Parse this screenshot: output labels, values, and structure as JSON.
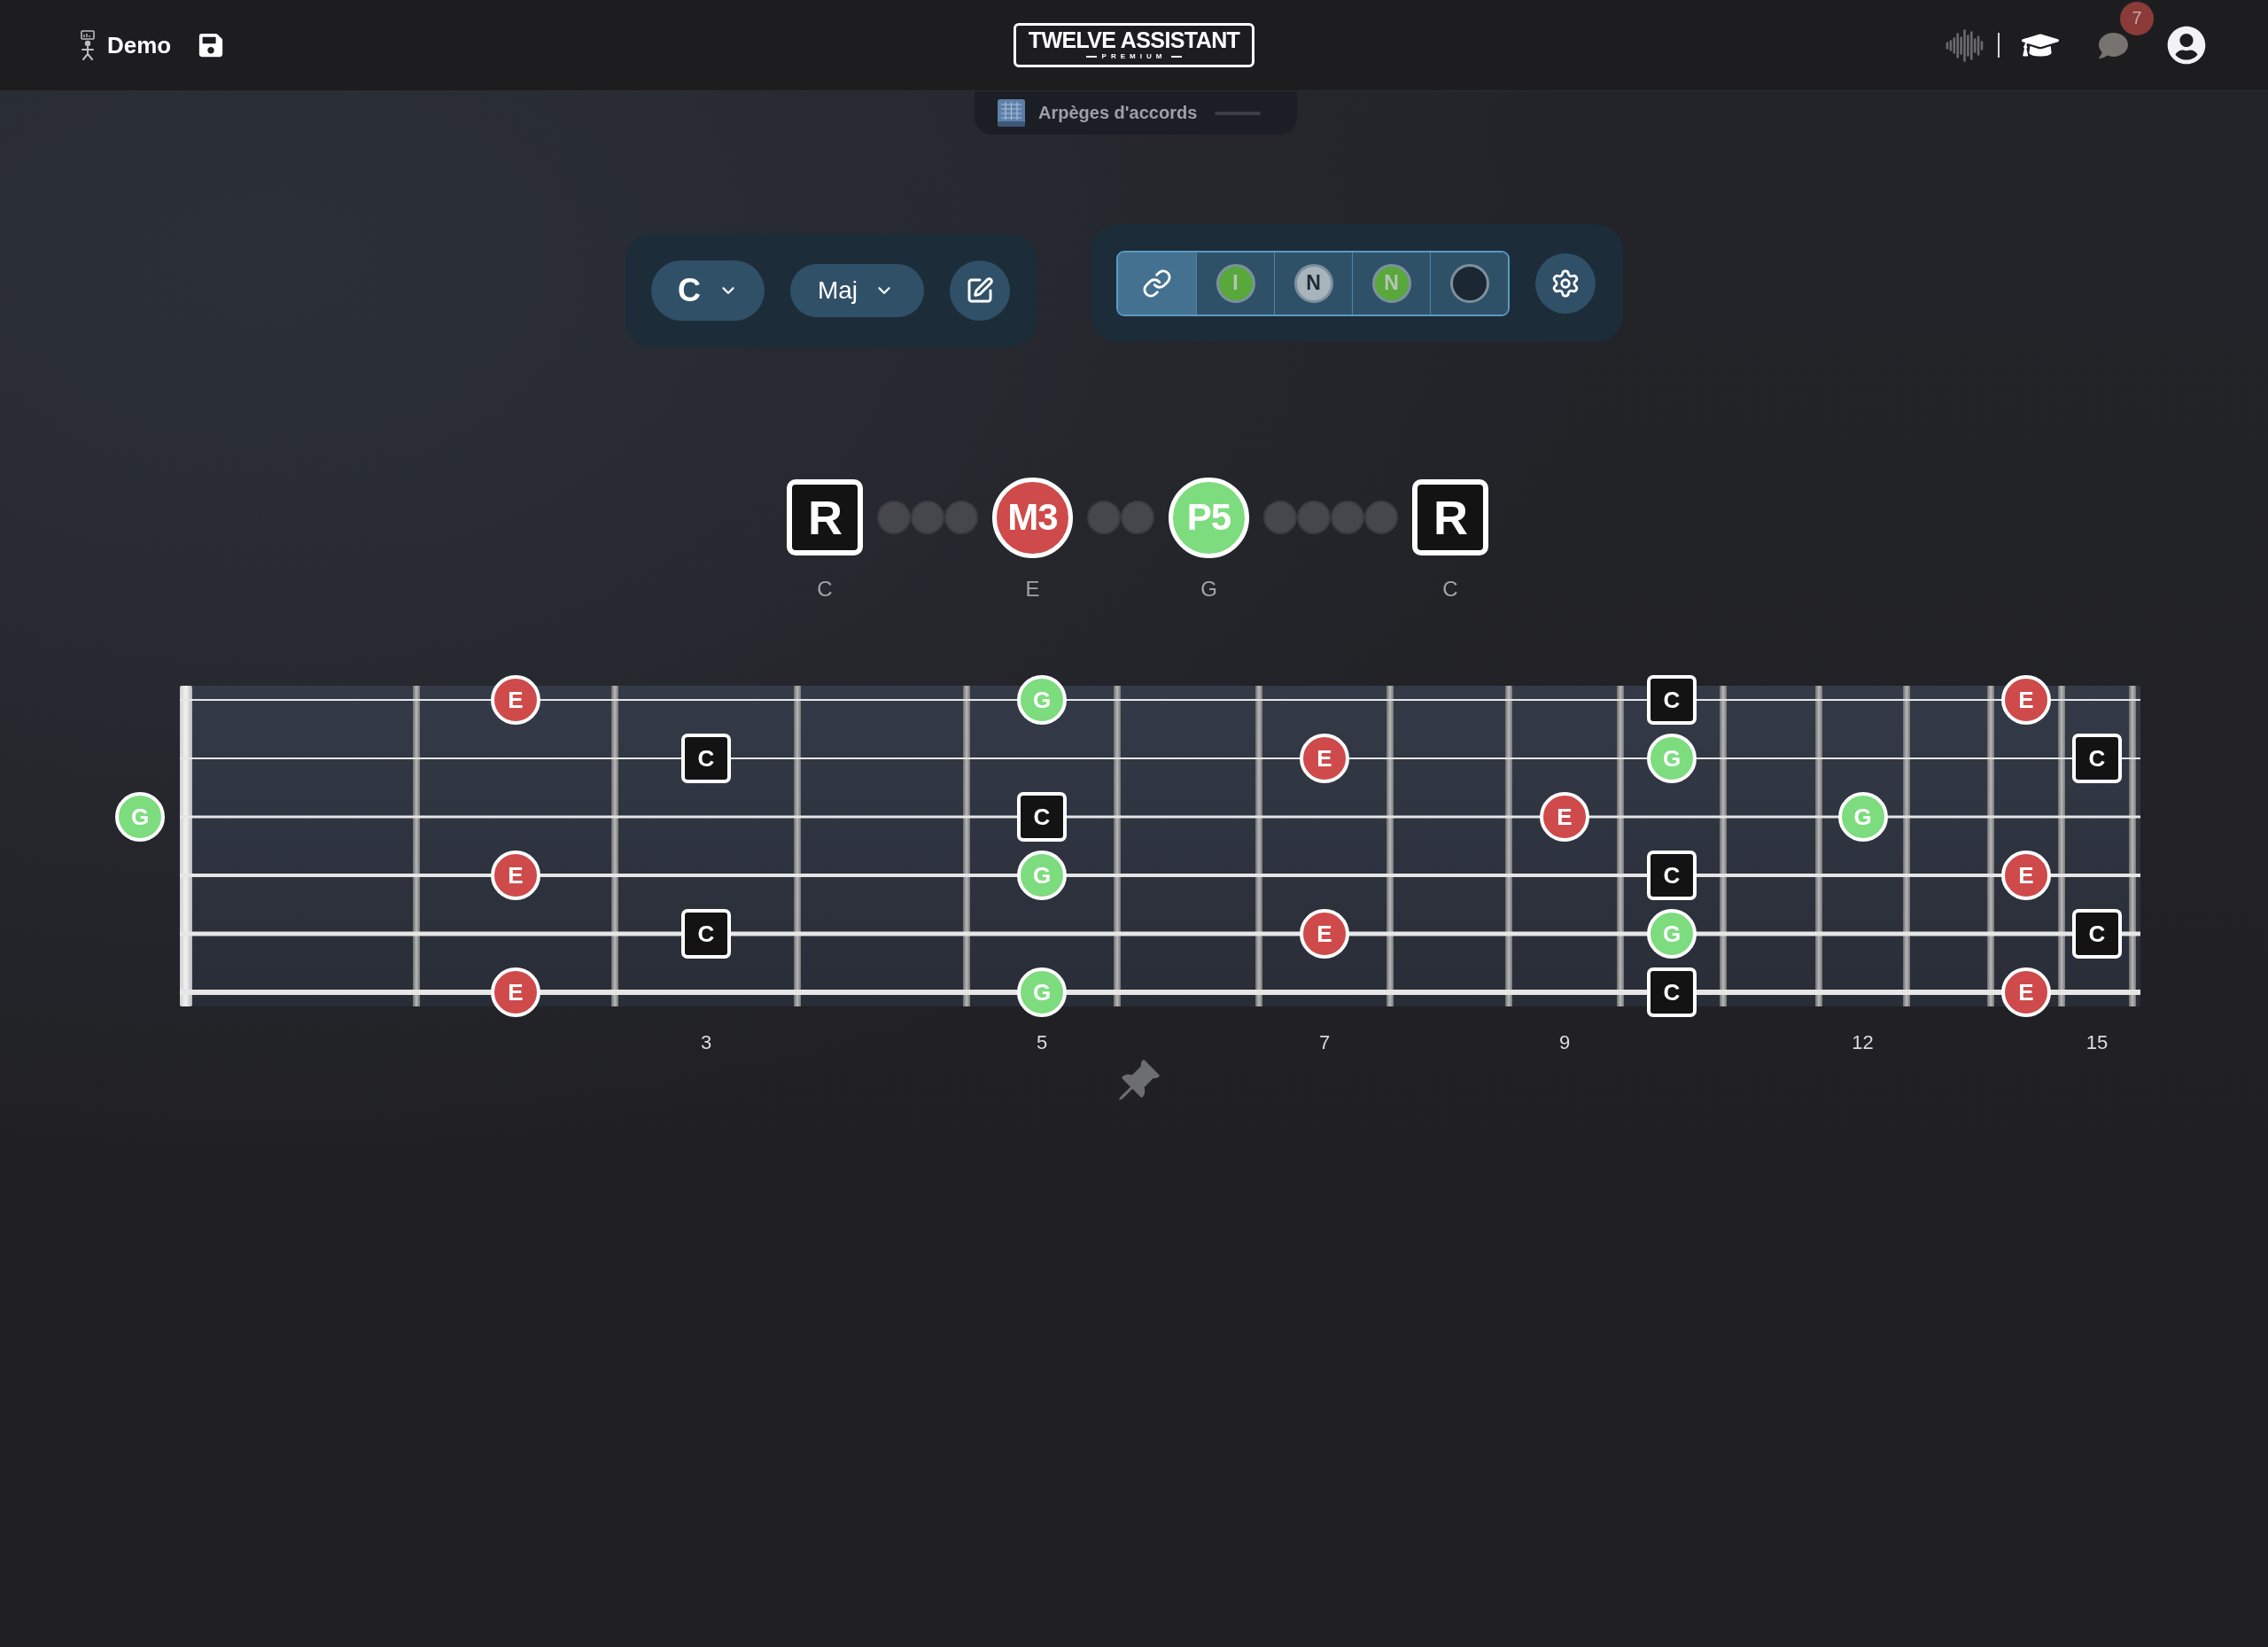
{
  "header": {
    "project_name": "Demo",
    "logo": {
      "title": "TWELVE ASSISTANT",
      "subtitle": "PREMIUM"
    },
    "notifications": {
      "count": "7"
    }
  },
  "mode_tab": {
    "label": "Arpèges d'accords"
  },
  "chord_controls": {
    "root": "C",
    "quality": "Maj"
  },
  "display_modes": [
    {
      "kind": "link",
      "selected": true
    },
    {
      "kind": "disc",
      "label": "I",
      "color": "#58a83c",
      "selected": false
    },
    {
      "kind": "disc",
      "label": "N",
      "color": "#a8b4bc",
      "selected": false
    },
    {
      "kind": "disc",
      "label": "N",
      "color": "#58a83c",
      "selected": false
    },
    {
      "kind": "disc",
      "color": "#1b2833",
      "selected": false
    }
  ],
  "intervals": [
    {
      "kind": "root",
      "label": "R",
      "note": "C"
    },
    {
      "kind": "gap"
    },
    {
      "kind": "gap"
    },
    {
      "kind": "gap"
    },
    {
      "kind": "third",
      "label": "M3",
      "note": "E"
    },
    {
      "kind": "gap"
    },
    {
      "kind": "gap"
    },
    {
      "kind": "fifth",
      "label": "P5",
      "note": "G"
    },
    {
      "kind": "gap"
    },
    {
      "kind": "gap"
    },
    {
      "kind": "gap"
    },
    {
      "kind": "gap"
    },
    {
      "kind": "root",
      "label": "R",
      "note": "C"
    }
  ],
  "fretboard": {
    "strings": [
      {
        "frets": [
          {
            "kind": "empty"
          },
          {
            "kind": "empty"
          },
          {
            "kind": "third",
            "label": "E"
          },
          {
            "kind": "empty"
          },
          {
            "kind": "empty"
          },
          {
            "kind": "fifth",
            "label": "G"
          },
          {
            "kind": "empty"
          },
          {
            "kind": "empty"
          },
          {
            "kind": "empty"
          },
          {
            "kind": "empty"
          },
          {
            "kind": "root",
            "label": "C"
          },
          {
            "kind": "empty"
          },
          {
            "kind": "empty"
          },
          {
            "kind": "empty"
          },
          {
            "kind": "third",
            "label": "E"
          },
          {
            "kind": "empty"
          }
        ]
      },
      {
        "frets": [
          {
            "kind": "empty"
          },
          {
            "kind": "empty"
          },
          {
            "kind": "empty"
          },
          {
            "kind": "root",
            "label": "C"
          },
          {
            "kind": "empty"
          },
          {
            "kind": "empty"
          },
          {
            "kind": "empty"
          },
          {
            "kind": "third",
            "label": "E"
          },
          {
            "kind": "empty"
          },
          {
            "kind": "empty"
          },
          {
            "kind": "fifth",
            "label": "G"
          },
          {
            "kind": "empty"
          },
          {
            "kind": "empty"
          },
          {
            "kind": "empty"
          },
          {
            "kind": "empty"
          },
          {
            "kind": "root",
            "label": "C"
          }
        ]
      },
      {
        "frets": [
          {
            "kind": "fifth",
            "label": "G"
          },
          {
            "kind": "empty"
          },
          {
            "kind": "empty"
          },
          {
            "kind": "empty"
          },
          {
            "kind": "empty"
          },
          {
            "kind": "root",
            "label": "C"
          },
          {
            "kind": "empty"
          },
          {
            "kind": "empty"
          },
          {
            "kind": "empty"
          },
          {
            "kind": "third",
            "label": "E"
          },
          {
            "kind": "empty"
          },
          {
            "kind": "empty"
          },
          {
            "kind": "fifth",
            "label": "G"
          },
          {
            "kind": "empty"
          },
          {
            "kind": "empty"
          },
          {
            "kind": "empty"
          }
        ]
      },
      {
        "frets": [
          {
            "kind": "empty"
          },
          {
            "kind": "empty"
          },
          {
            "kind": "third",
            "label": "E"
          },
          {
            "kind": "empty"
          },
          {
            "kind": "empty"
          },
          {
            "kind": "fifth",
            "label": "G"
          },
          {
            "kind": "empty"
          },
          {
            "kind": "empty"
          },
          {
            "kind": "empty"
          },
          {
            "kind": "empty"
          },
          {
            "kind": "root",
            "label": "C"
          },
          {
            "kind": "empty"
          },
          {
            "kind": "empty"
          },
          {
            "kind": "empty"
          },
          {
            "kind": "third",
            "label": "E"
          },
          {
            "kind": "empty"
          }
        ]
      },
      {
        "frets": [
          {
            "kind": "empty"
          },
          {
            "kind": "empty"
          },
          {
            "kind": "empty"
          },
          {
            "kind": "root",
            "label": "C"
          },
          {
            "kind": "empty"
          },
          {
            "kind": "empty"
          },
          {
            "kind": "empty"
          },
          {
            "kind": "third",
            "label": "E"
          },
          {
            "kind": "empty"
          },
          {
            "kind": "empty"
          },
          {
            "kind": "fifth",
            "label": "G"
          },
          {
            "kind": "empty"
          },
          {
            "kind": "empty"
          },
          {
            "kind": "empty"
          },
          {
            "kind": "empty"
          },
          {
            "kind": "root",
            "label": "C"
          }
        ]
      },
      {
        "frets": [
          {
            "kind": "empty"
          },
          {
            "kind": "empty"
          },
          {
            "kind": "third",
            "label": "E"
          },
          {
            "kind": "empty"
          },
          {
            "kind": "empty"
          },
          {
            "kind": "fifth",
            "label": "G"
          },
          {
            "kind": "empty"
          },
          {
            "kind": "empty"
          },
          {
            "kind": "empty"
          },
          {
            "kind": "empty"
          },
          {
            "kind": "root",
            "label": "C"
          },
          {
            "kind": "empty"
          },
          {
            "kind": "empty"
          },
          {
            "kind": "empty"
          },
          {
            "kind": "third",
            "label": "E"
          },
          {
            "kind": "empty"
          }
        ]
      }
    ],
    "fret_numbers": [
      {
        "fret": "3"
      },
      {
        "fret": "5"
      },
      {
        "fret": "7"
      },
      {
        "fret": "9"
      },
      {
        "fret": "12"
      },
      {
        "fret": "15"
      }
    ]
  }
}
